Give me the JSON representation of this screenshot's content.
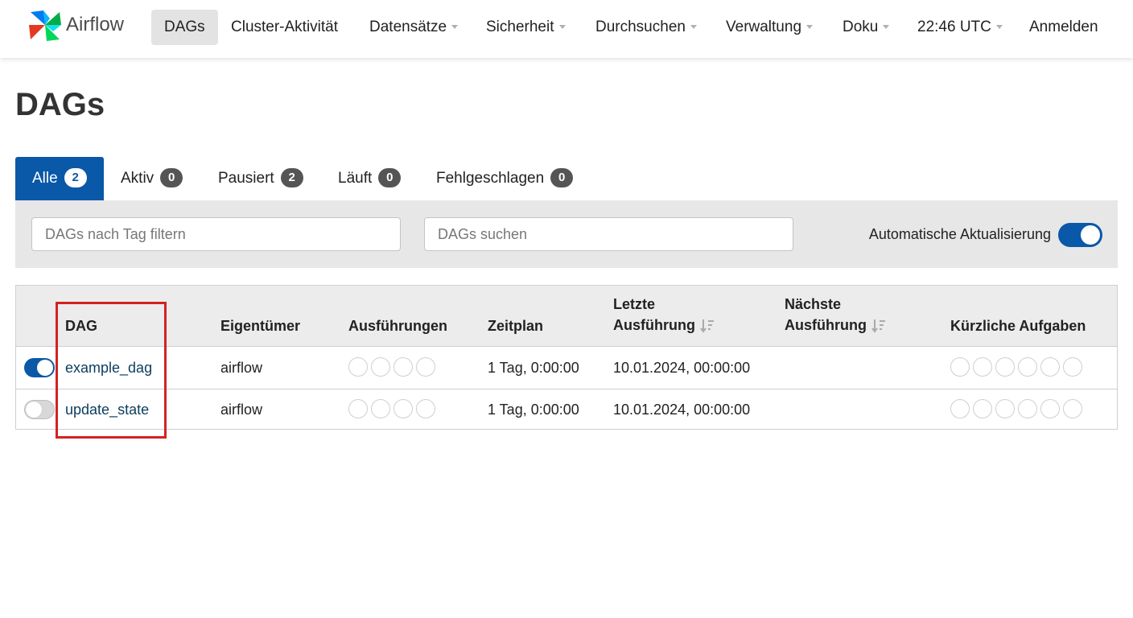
{
  "brand": {
    "name": "Airflow",
    "icon": "airflow-pinwheel-icon"
  },
  "nav": {
    "items": [
      {
        "label": "DAGs",
        "active": true,
        "dropdown": false
      },
      {
        "label": "Cluster-Aktivität",
        "dropdown": false
      },
      {
        "label": "Datensätze",
        "dropdown": true
      },
      {
        "label": "Sicherheit",
        "dropdown": true
      },
      {
        "label": "Durchsuchen",
        "dropdown": true
      },
      {
        "label": "Verwaltung",
        "dropdown": true
      },
      {
        "label": "Doku",
        "dropdown": true
      },
      {
        "label": "22:46 UTC",
        "dropdown": true
      },
      {
        "label": "Anmelden",
        "dropdown": false
      }
    ]
  },
  "page": {
    "title": "DAGs"
  },
  "tabs": [
    {
      "label": "Alle",
      "count": "2",
      "active": true
    },
    {
      "label": "Aktiv",
      "count": "0"
    },
    {
      "label": "Pausiert",
      "count": "2"
    },
    {
      "label": "Läuft",
      "count": "0"
    },
    {
      "label": "Fehlgeschlagen",
      "count": "0"
    }
  ],
  "filters": {
    "tag_placeholder": "DAGs nach Tag filtern",
    "search_placeholder": "DAGs suchen",
    "auto_refresh_label": "Automatische Aktualisierung",
    "auto_refresh_on": true
  },
  "table": {
    "headers": {
      "dag": "DAG",
      "owner": "Eigentümer",
      "runs": "Ausführungen",
      "schedule": "Zeitplan",
      "last_run_1": "Letzte",
      "last_run_2": "Ausführung",
      "next_run_1": "Nächste",
      "next_run_2": "Ausführung",
      "recent_tasks": "Kürzliche Aufgaben"
    },
    "rows": [
      {
        "dag_id": "example_dag",
        "owner": "airflow",
        "schedule": "1 Tag, 0:00:00",
        "last_run": "10.01.2024, 00:00:00",
        "next_run": "",
        "enabled": true
      },
      {
        "dag_id": "update_state",
        "owner": "airflow",
        "schedule": "1 Tag, 0:00:00",
        "last_run": "10.01.2024, 00:00:00",
        "next_run": "",
        "enabled": false
      }
    ]
  },
  "colors": {
    "primary": "#0a58a8",
    "highlight": "#d32222",
    "link": "#0b3d5e"
  }
}
